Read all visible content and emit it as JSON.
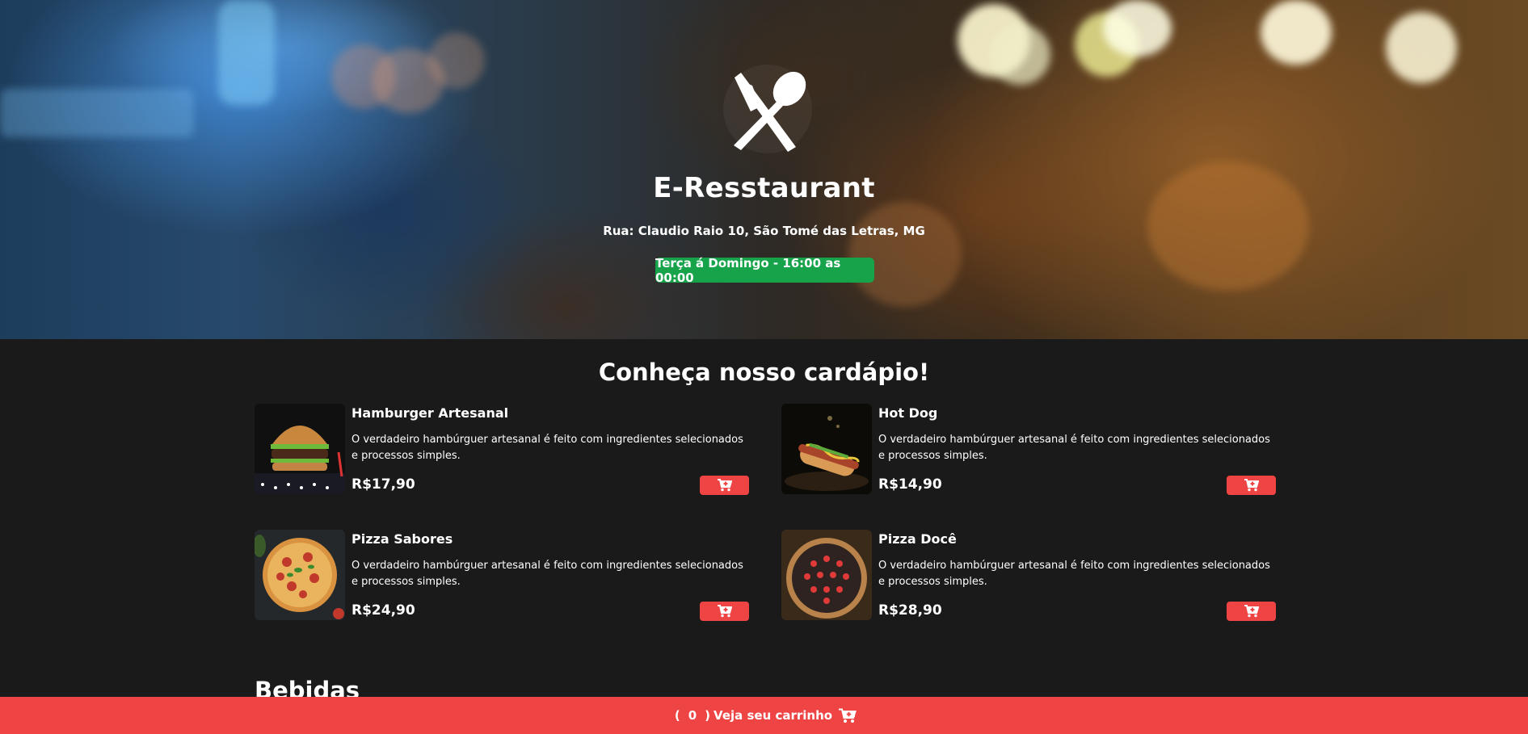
{
  "restaurant": {
    "name": "E-Resstaurant",
    "address": "Rua: Claudio Raio 10, São Tomé das Letras, MG",
    "hours": "Terça á Domingo - 16:00 as 00:00",
    "logo_icon": "fork-spoon-icon",
    "hours_badge_color": "#16a34a"
  },
  "menu": {
    "title": "Conheça nosso cardápio!",
    "items": [
      {
        "name": "Hamburger Artesanal",
        "description": "O verdadeiro hambúrguer artesanal é feito com ingredientes selecionados e processos simples.",
        "price": "R$17,90",
        "image": "burger-image"
      },
      {
        "name": "Hot Dog",
        "description": "O verdadeiro hambúrguer artesanal é feito com ingredientes selecionados e processos simples.",
        "price": "R$14,90",
        "image": "hot-dog-image"
      },
      {
        "name": "Pizza Sabores",
        "description": "O verdadeiro hambúrguer artesanal é feito com ingredientes selecionados e processos simples.",
        "price": "R$24,90",
        "image": "pizza-image"
      },
      {
        "name": "Pizza Docê",
        "description": "O verdadeiro hambúrguer artesanal é feito com ingredientes selecionados e processos simples.",
        "price": "R$28,90",
        "image": "sweet-pizza-image"
      }
    ],
    "add_button_icon": "cart-plus-icon"
  },
  "drinks": {
    "title": "Bebidas"
  },
  "cart": {
    "open_paren": "(",
    "count": "0",
    "close_paren": ")",
    "label": "Veja seu carrinho",
    "icon": "cart-icon",
    "accent_color": "#ef4444"
  }
}
